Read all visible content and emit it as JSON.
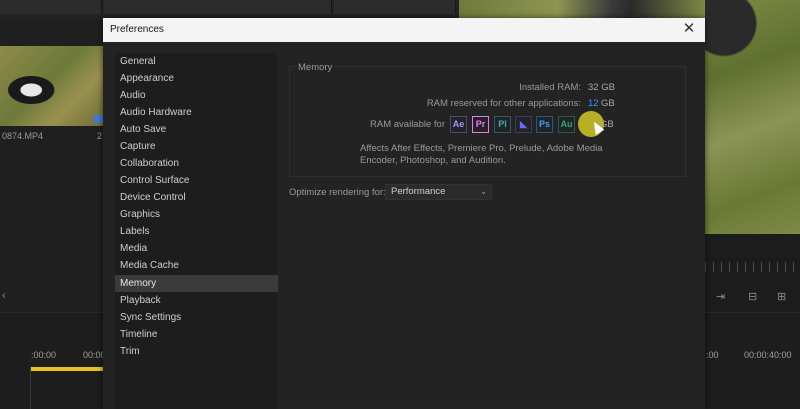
{
  "background": {
    "clip_name": "0874.MP4",
    "clip_duration": "2",
    "timecode_left": ":00:00",
    "timecode_mid": "00:00",
    "timecode_right_a": ":00",
    "timecode_right_b": "00:00:40:00"
  },
  "dialog": {
    "title": "Preferences",
    "close_icon": "close-icon"
  },
  "sidebar": {
    "items": [
      {
        "label": "General"
      },
      {
        "label": "Appearance"
      },
      {
        "label": "Audio"
      },
      {
        "label": "Audio Hardware"
      },
      {
        "label": "Auto Save"
      },
      {
        "label": "Capture"
      },
      {
        "label": "Collaboration"
      },
      {
        "label": "Control Surface"
      },
      {
        "label": "Device Control"
      },
      {
        "label": "Graphics"
      },
      {
        "label": "Labels"
      },
      {
        "label": "Media"
      },
      {
        "label": "Media Cache"
      },
      {
        "label": "Memory"
      },
      {
        "label": "Playback"
      },
      {
        "label": "Sync Settings"
      },
      {
        "label": "Timeline"
      },
      {
        "label": "Trim"
      }
    ],
    "selected": "Memory"
  },
  "memory": {
    "section_title": "Memory",
    "installed_ram_label": "Installed RAM:",
    "installed_ram_value": "32 GB",
    "reserved_label": "RAM reserved for other applications:",
    "reserved_value": "12",
    "reserved_unit": "GB",
    "available_label": "RAM available for",
    "available_unit": "GB",
    "apps": [
      {
        "abbr": "Ae",
        "color": "#9a9aff"
      },
      {
        "abbr": "Pr",
        "color": "#ea77ff"
      },
      {
        "abbr": "Pl",
        "color": "#3ea9c6"
      },
      {
        "abbr": "",
        "color": "#6a6aff"
      },
      {
        "abbr": "Ps",
        "color": "#31a8ff"
      },
      {
        "abbr": "Au",
        "color": "#2fa67a"
      }
    ],
    "affects_text": "Affects After Effects, Premiere Pro, Prelude, Adobe Media Encoder, Photoshop, and Audition."
  },
  "rendering": {
    "label": "Optimize rendering for:",
    "value": "Performance"
  },
  "colors": {
    "accent_blue": "#4a8cff",
    "cursor_highlight": "#d2c828",
    "timeline_marker": "#e9c22a"
  }
}
